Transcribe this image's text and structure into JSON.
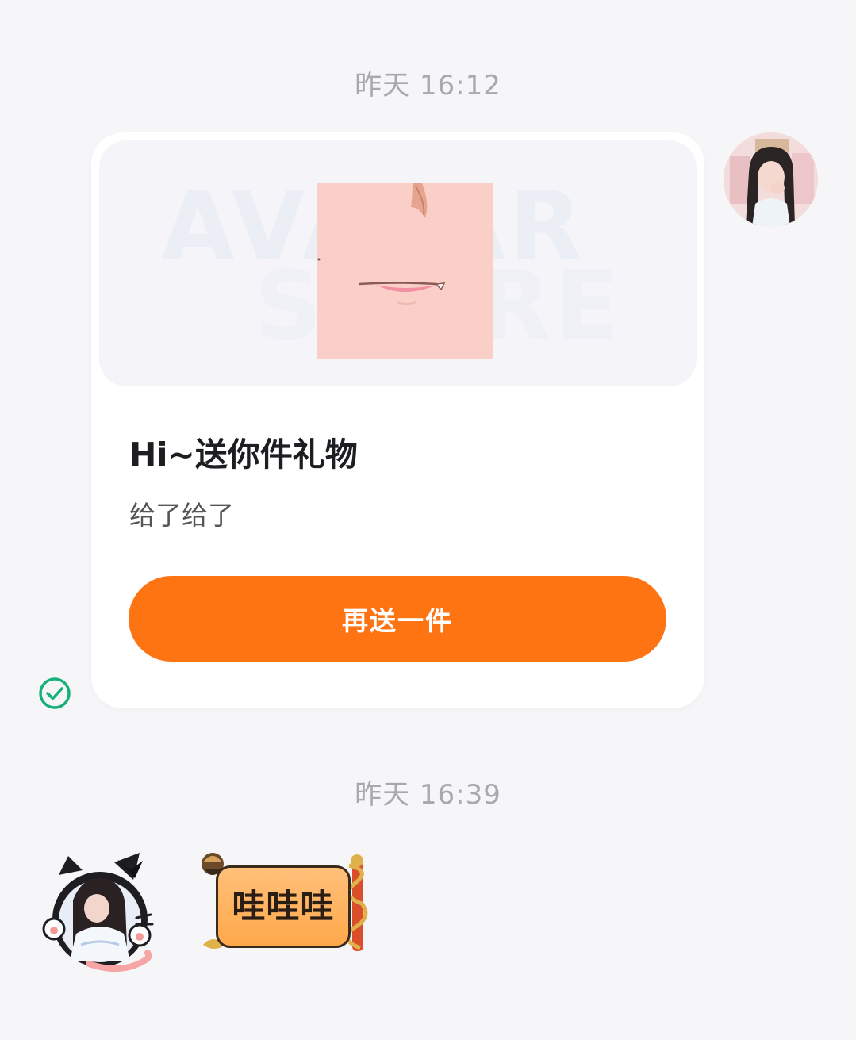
{
  "messages": {
    "timestamp_1": "昨天 16:12",
    "gift_card": {
      "watermark_line1": "AVATAR",
      "watermark_line2": "STORE",
      "title": "Hi~送你件礼物",
      "subtitle": "给了给了",
      "button_label": "再送一件"
    },
    "sent_status_icon": "check-circle-icon",
    "timestamp_2": "昨天 16:39",
    "sticker_text": "哇哇哇"
  },
  "colors": {
    "background": "#f6f6f8",
    "accent": "#fe7312",
    "status_green": "#18b07a",
    "timestamp_gray": "#a8a8ad"
  }
}
